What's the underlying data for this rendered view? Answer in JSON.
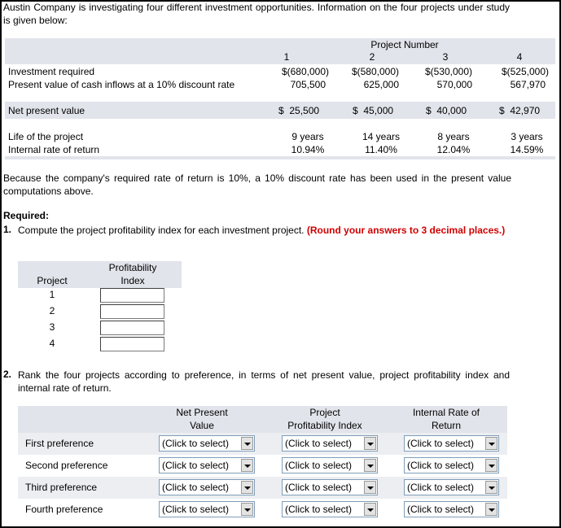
{
  "intro": "Austin Company is investigating four different investment opportunities. Information on the four projects under study is given below:",
  "table": {
    "group_header": "Project Number",
    "projects": [
      "1",
      "2",
      "3",
      "4"
    ],
    "rows": [
      {
        "label": "Investment required",
        "values": [
          "$(680,000)",
          "$(580,000)",
          "$(530,000)",
          "$(525,000)"
        ]
      },
      {
        "label": "Present value of cash inflows at a 10% discount rate",
        "values": [
          "705,500",
          "625,000",
          "570,000",
          "567,970"
        ]
      },
      {
        "label": "Net present value",
        "values": [
          "$  25,500",
          "$  45,000",
          "$  40,000",
          "$  42,970"
        ]
      },
      {
        "label": "Life of the project",
        "values": [
          "9 years",
          "14 years",
          "8 years",
          "3 years"
        ]
      },
      {
        "label": "Internal rate of return",
        "values": [
          "10.94%",
          "11.40%",
          "12.04%",
          "14.59%"
        ]
      }
    ]
  },
  "note": "Because the company's required rate of return is 10%, a 10% discount rate has been used in the present value computations above.",
  "required_label": "Required:",
  "q1": {
    "number": "1.",
    "text": "Compute the project profitability index for each investment project.",
    "instruction": "(Round your answers to 3 decimal places.)"
  },
  "pi_table": {
    "col_project": "Project",
    "col_index_line1": "Profitability",
    "col_index_line2": "Index",
    "rows": [
      "1",
      "2",
      "3",
      "4"
    ]
  },
  "q2": {
    "number": "2.",
    "text": "Rank the four projects according to preference, in terms of net present value, project profitability index and internal rate of return."
  },
  "rank_table": {
    "columns": [
      {
        "line1": "Net Present",
        "line2": "Value"
      },
      {
        "line1": "Project",
        "line2": "Profitability Index"
      },
      {
        "line1": "Internal Rate of",
        "line2": "Return"
      }
    ],
    "rows": [
      "First preference",
      "Second preference",
      "Third preference",
      "Fourth preference"
    ],
    "select_value": "(Click to select)"
  }
}
